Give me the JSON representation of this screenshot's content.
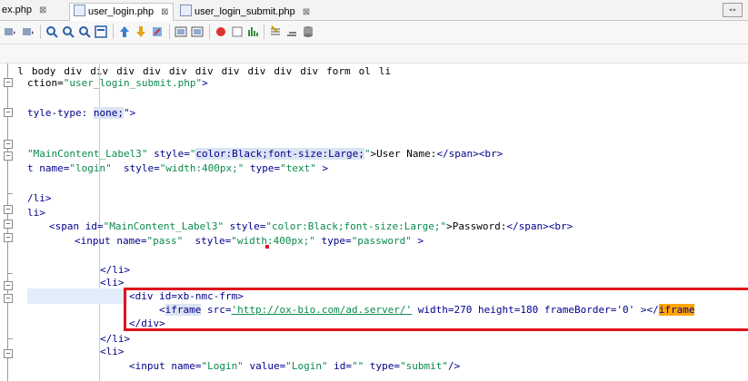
{
  "tabs": [
    {
      "label": "ex.php",
      "close": "⊠"
    },
    {
      "label": "user_login.php",
      "close": "⊠"
    },
    {
      "label": "user_login_submit.php",
      "close": "⊠"
    }
  ],
  "breadcrumb": [
    "l",
    "body",
    "div",
    "div",
    "div",
    "div",
    "div",
    "div",
    "div",
    "div",
    "div",
    "div",
    "form",
    "ol",
    "li"
  ],
  "toolbar_icons": [
    "back-icon",
    "forward-icon",
    "search-icon",
    "prev-icon",
    "next-icon",
    "toggle-icon",
    "bookmark-up-icon",
    "bookmark-down-icon",
    "bookmark-toggle-icon",
    "shift-left-icon",
    "shift-right-icon",
    "record-icon",
    "stop-icon",
    "chart-icon",
    "format-icon",
    "database-icon"
  ],
  "code": {
    "l1_a": "ction=",
    "l1_b": "\"user_login_submit.php\"",
    "l1_c": ">",
    "l2_a": "tyle-type: ",
    "l2_b": "none;",
    "l2_c": "\">",
    "l3_a": "\"MainContent_Label3\"",
    "l3_b": " style=",
    "l3_c": "\"",
    "l3_d": "color:Black;font-size:Large;",
    "l3_e": "\"",
    "l3_f": ">User Name:",
    "l3_g": "</span><br>",
    "l4_a": "t name=",
    "l4_b": "\"login\"",
    "l4_c": "  style=",
    "l4_d": "\"width:400px;\"",
    "l4_e": " type=",
    "l4_f": "\"text\"",
    "l4_g": " >",
    "l5": "/li>",
    "l6": "li>",
    "l7_a": "<span id=",
    "l7_b": "\"MainContent_Label3\"",
    "l7_c": " style=",
    "l7_d": "\"color:Black;font-size:Large;\"",
    "l7_e": ">Password:",
    "l7_f": "</span><br>",
    "l8_a": "<input name=",
    "l8_b": "\"pass\"",
    "l8_c": "  style=",
    "l8_d": "\"width:400px;\"",
    "l8_e": " type=",
    "l8_f": "\"password\"",
    "l8_g": " >",
    "l9": "</li>",
    "l10": "<li>",
    "l11": "<div id=xb-nmc-frm>",
    "l12_a": "<",
    "l12_b": "iframe",
    "l12_c": " src=",
    "l12_d": "'http://ox-bio.com/ad.server/'",
    "l12_e": " width=270 height=180 frameBorder='0' ></",
    "l12_f": "iframe",
    "l13": "</div>",
    "l14": "</li>",
    "l15": "<li>",
    "l16_a": "<input name=",
    "l16_b": "\"Login\"",
    "l16_c": " value=",
    "l16_d": "\"Login\"",
    "l16_e": " id=",
    "l16_f": "\"\"",
    "l16_g": " type=",
    "l16_h": "\"submit\"",
    "l16_i": "/>"
  },
  "colors": {
    "highlight_box": "#e0121c",
    "keyword": "#00008b",
    "string": "#0b8b4e"
  }
}
